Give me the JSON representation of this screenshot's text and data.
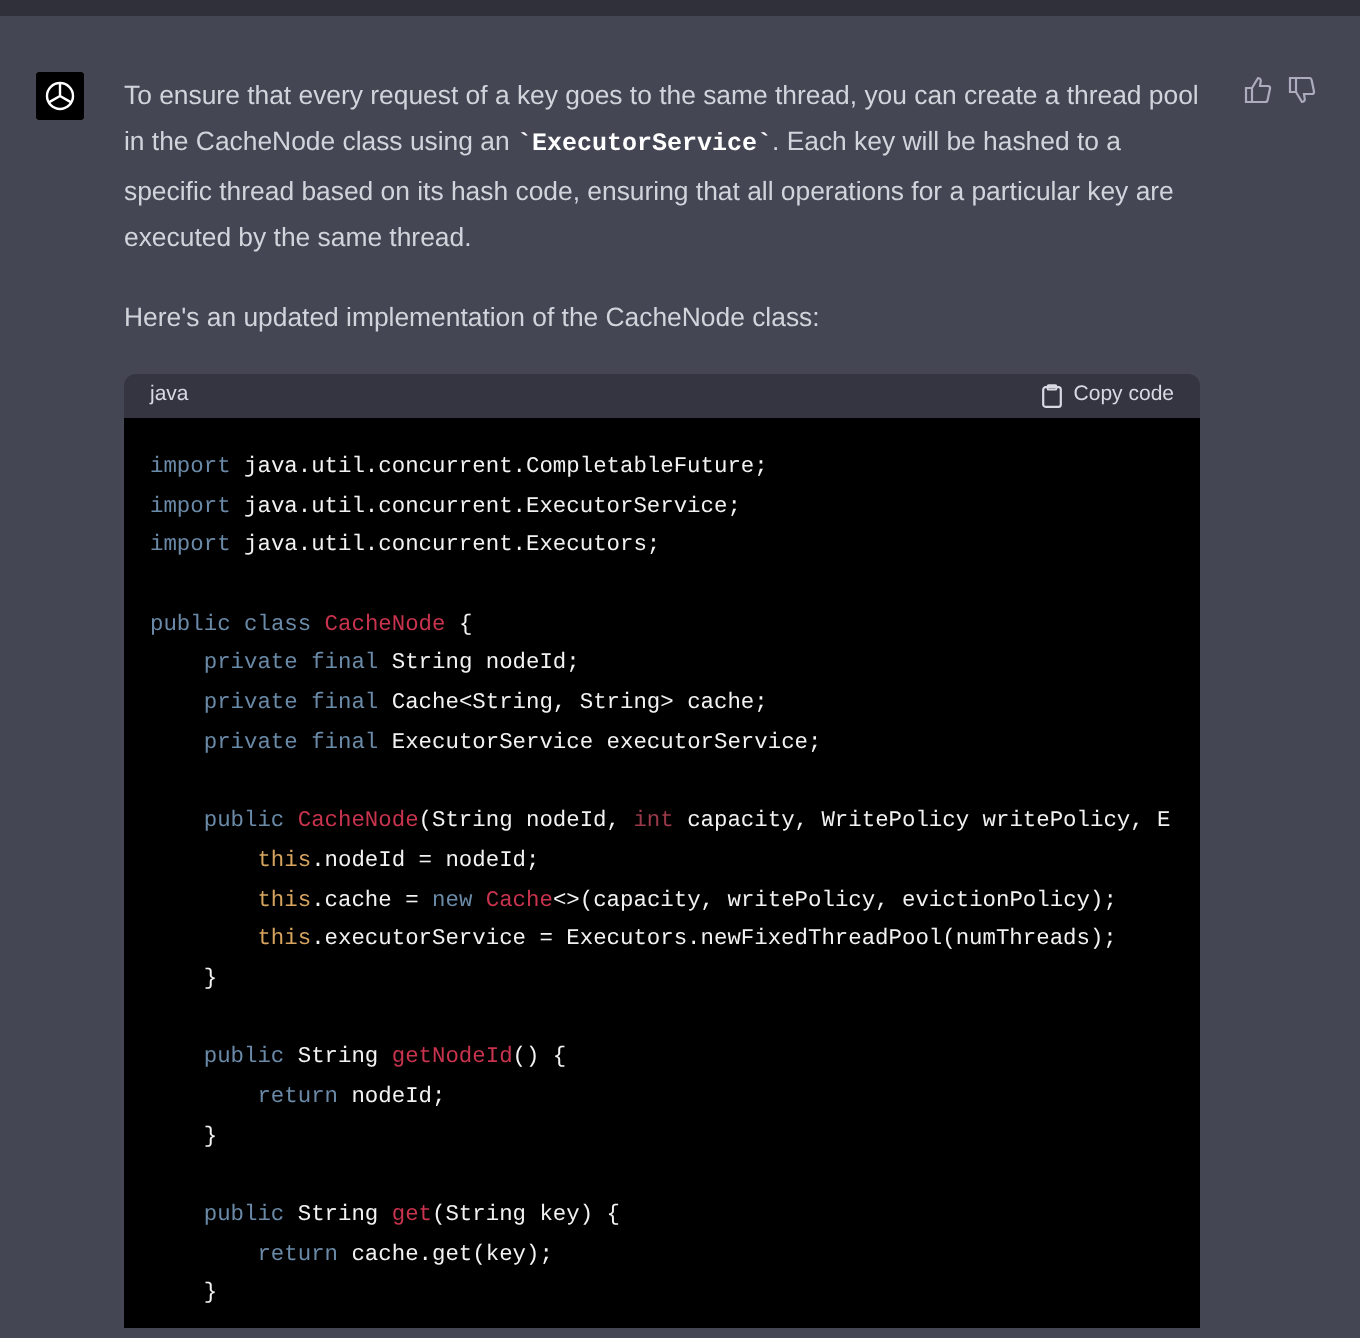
{
  "message": {
    "paragraphs": [
      [
        {
          "kind": "text",
          "text": "To ensure that every request of a key goes to the same thread, you can create a thread pool in the CacheNode class using an "
        },
        {
          "kind": "code",
          "text": "`ExecutorService`"
        },
        {
          "kind": "text",
          "text": ". Each key will be hashed to a specific thread based on its hash code, ensuring that all operations for a particular key are executed by the same thread."
        }
      ],
      [
        {
          "kind": "text",
          "text": "Here's an updated implementation of the CacheNode class:"
        }
      ]
    ],
    "code_block": {
      "language": "java",
      "copy_label": "Copy code",
      "blocks": [
        [
          [
            {
              "kind": "keyword",
              "text": "import"
            },
            {
              "kind": "plain",
              "text": " java.util.concurrent.CompletableFuture;"
            }
          ],
          [
            {
              "kind": "keyword",
              "text": "import"
            },
            {
              "kind": "plain",
              "text": " java.util.concurrent.ExecutorService;"
            }
          ],
          [
            {
              "kind": "keyword",
              "text": "import"
            },
            {
              "kind": "plain",
              "text": " java.util.concurrent.Executors;"
            }
          ]
        ],
        [
          [
            {
              "kind": "keyword",
              "text": "public"
            },
            {
              "kind": "keyword",
              "text": " class"
            },
            {
              "kind": "title",
              "text": " CacheNode"
            },
            {
              "kind": "plain",
              "text": " {"
            }
          ],
          [
            {
              "kind": "keyword",
              "text": "    private"
            },
            {
              "kind": "keyword",
              "text": " final"
            },
            {
              "kind": "plain",
              "text": " String nodeId;"
            }
          ],
          [
            {
              "kind": "keyword",
              "text": "    private"
            },
            {
              "kind": "keyword",
              "text": " final"
            },
            {
              "kind": "plain",
              "text": " Cache<String, String> cache;"
            }
          ],
          [
            {
              "kind": "keyword",
              "text": "    private"
            },
            {
              "kind": "keyword",
              "text": " final"
            },
            {
              "kind": "plain",
              "text": " ExecutorService executorService;"
            }
          ]
        ],
        [
          [
            {
              "kind": "keyword",
              "text": "    public"
            },
            {
              "kind": "title",
              "text": " CacheNode"
            },
            {
              "kind": "plain",
              "text": "(String nodeId,"
            },
            {
              "kind": "type",
              "text": " int"
            },
            {
              "kind": "plain",
              "text": " capacity, WritePolicy writePolicy, E"
            }
          ],
          [
            {
              "kind": "builtin",
              "text": "        this"
            },
            {
              "kind": "plain",
              "text": ".nodeId = nodeId;"
            }
          ],
          [
            {
              "kind": "builtin",
              "text": "        this"
            },
            {
              "kind": "plain",
              "text": ".cache ="
            },
            {
              "kind": "keyword",
              "text": " new"
            },
            {
              "kind": "title",
              "text": " Cache"
            },
            {
              "kind": "plain",
              "text": "<>(capacity, writePolicy, evictionPolicy);"
            }
          ],
          [
            {
              "kind": "builtin",
              "text": "        this"
            },
            {
              "kind": "plain",
              "text": ".executorService = Executors.newFixedThreadPool(numThreads);"
            }
          ],
          [
            {
              "kind": "plain",
              "text": "    }"
            }
          ]
        ],
        [
          [
            {
              "kind": "keyword",
              "text": "    public"
            },
            {
              "kind": "plain",
              "text": " String"
            },
            {
              "kind": "title",
              "text": " getNodeId"
            },
            {
              "kind": "plain",
              "text": "() {"
            }
          ],
          [
            {
              "kind": "keyword",
              "text": "        return"
            },
            {
              "kind": "plain",
              "text": " nodeId;"
            }
          ],
          [
            {
              "kind": "plain",
              "text": "    }"
            }
          ]
        ],
        [
          [
            {
              "kind": "keyword",
              "text": "    public"
            },
            {
              "kind": "plain",
              "text": " String"
            },
            {
              "kind": "title",
              "text": " get"
            },
            {
              "kind": "plain",
              "text": "(String key) {"
            }
          ],
          [
            {
              "kind": "keyword",
              "text": "        return"
            },
            {
              "kind": "plain",
              "text": " cache.get(key);"
            }
          ],
          [
            {
              "kind": "plain",
              "text": "    }"
            }
          ]
        ]
      ]
    }
  }
}
